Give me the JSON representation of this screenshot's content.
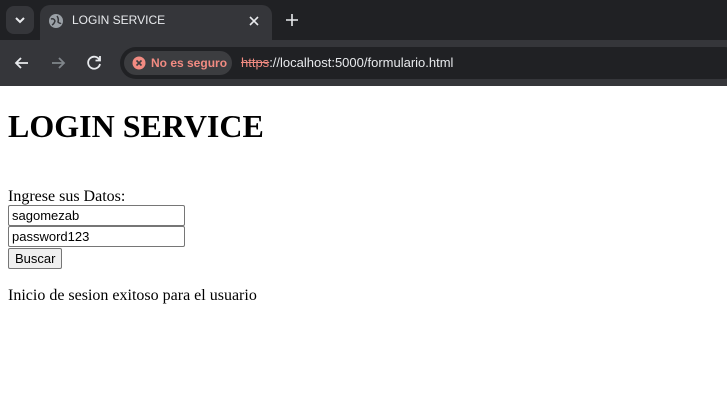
{
  "browser": {
    "tab": {
      "title": "LOGIN SERVICE"
    },
    "address_bar": {
      "security_label": "No es seguro",
      "url_scheme": "https",
      "url_rest": "://localhost:5000/formulario.html"
    }
  },
  "page": {
    "heading": "LOGIN SERVICE",
    "form": {
      "prompt": "Ingrese sus Datos:",
      "username_value": "sagomezab",
      "password_value": "password123",
      "submit_label": "Buscar"
    },
    "result_message": "Inicio de sesion exitoso para el usuario"
  },
  "icons": {
    "tab_search": "chevron-down-icon",
    "favicon": "globe-icon",
    "close": "close-icon",
    "new_tab": "plus-icon",
    "back": "arrow-left-icon",
    "forward": "arrow-right-icon",
    "reload": "reload-icon",
    "security": "warning-circle-icon"
  },
  "colors": {
    "warning": "#f28b82"
  }
}
